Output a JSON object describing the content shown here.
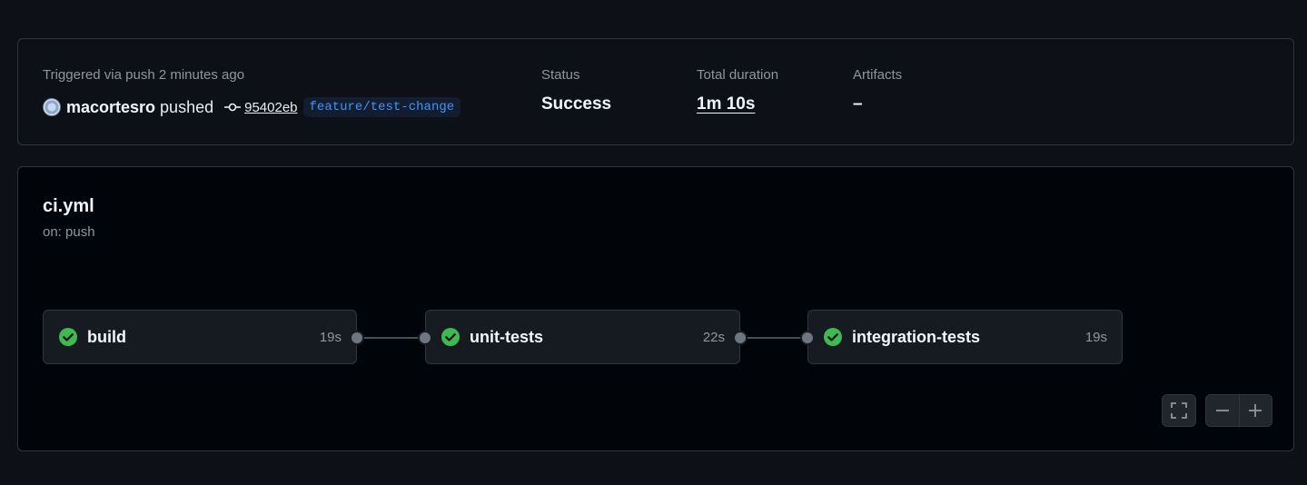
{
  "summary": {
    "trigger_text": "Triggered via push 2 minutes ago",
    "user": "macortesro",
    "action": "pushed",
    "commit_sha": "95402eb",
    "branch": "feature/test-change",
    "status_label": "Status",
    "status_value": "Success",
    "duration_label": "Total duration",
    "duration_value": "1m 10s",
    "artifacts_label": "Artifacts",
    "artifacts_value": "–"
  },
  "workflow": {
    "file": "ci.yml",
    "trigger": "on: push",
    "jobs": [
      {
        "name": "build",
        "duration": "19s",
        "status": "success"
      },
      {
        "name": "unit-tests",
        "duration": "22s",
        "status": "success"
      },
      {
        "name": "integration-tests",
        "duration": "19s",
        "status": "success"
      }
    ]
  },
  "icons": {
    "job_status": "check-circle-icon",
    "commit": "git-commit-icon",
    "fullscreen": "fullscreen-icon",
    "zoom_out": "minus-icon",
    "zoom_in": "plus-icon"
  },
  "colors": {
    "success": "#3fb950",
    "branch": "#4493f8",
    "background": "#0d1117"
  }
}
